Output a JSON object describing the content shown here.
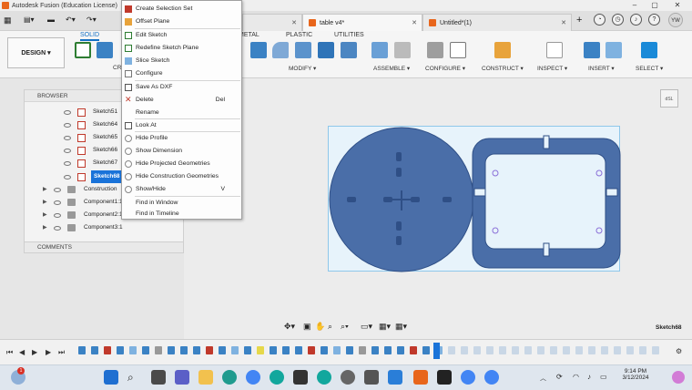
{
  "window": {
    "title": "Autodesk Fusion (Education License)",
    "minimize": "–",
    "maximize": "▢",
    "close": "✕"
  },
  "tabs": [
    {
      "label": "",
      "active": false
    },
    {
      "label": "table v4*",
      "active": true
    },
    {
      "label": "Untitled*(1)",
      "active": false
    }
  ],
  "ribbon": {
    "workspace": "DESIGN ▾",
    "tabs": [
      "SOLID",
      "METAL",
      "PLASTIC",
      "UTILITIES"
    ],
    "groups": [
      "CR",
      "MODIFY ▾",
      "ASSEMBLE ▾",
      "CONFIGURE ▾",
      "CONSTRUCT ▾",
      "INSPECT ▾",
      "INSERT ▾",
      "SELECT ▾"
    ]
  },
  "user": {
    "initials": "YW"
  },
  "browser": {
    "title": "BROWSER",
    "rows": [
      {
        "label": "Sketch51",
        "type": "sketch",
        "selected": false
      },
      {
        "label": "Sketch64",
        "type": "sketch",
        "selected": false
      },
      {
        "label": "Sketch65",
        "type": "sketch",
        "selected": false
      },
      {
        "label": "Sketch66",
        "type": "sketch",
        "selected": false
      },
      {
        "label": "Sketch67",
        "type": "sketch",
        "selected": false
      },
      {
        "label": "Sketch68",
        "type": "sketch",
        "selected": true
      },
      {
        "label": "Construction",
        "type": "folder",
        "selected": false
      },
      {
        "label": "Component1:1",
        "type": "component",
        "selected": false
      },
      {
        "label": "Component2:1",
        "type": "component",
        "selected": false
      },
      {
        "label": "Component3:1",
        "type": "component",
        "selected": false
      }
    ],
    "comments": "COMMENTS"
  },
  "context_menu": {
    "items": [
      {
        "label": "Create Selection Set",
        "shortcut": ""
      },
      {
        "label": "Offset Plane",
        "shortcut": ""
      },
      {
        "label": "Edit Sketch",
        "shortcut": ""
      },
      {
        "label": "Redefine Sketch Plane",
        "shortcut": ""
      },
      {
        "label": "Slice Sketch",
        "shortcut": ""
      },
      {
        "label": "Configure",
        "shortcut": ""
      },
      {
        "label": "Save As DXF",
        "shortcut": ""
      },
      {
        "label": "Delete",
        "shortcut": "Del"
      },
      {
        "label": "Rename",
        "shortcut": ""
      },
      {
        "label": "Look At",
        "shortcut": ""
      },
      {
        "label": "Hide Profile",
        "shortcut": ""
      },
      {
        "label": "Show Dimension",
        "shortcut": ""
      },
      {
        "label": "Hide Projected Geometries",
        "shortcut": ""
      },
      {
        "label": "Hide Construction Geometries",
        "shortcut": ""
      },
      {
        "label": "Show/Hide",
        "shortcut": "V"
      },
      {
        "label": "Find in Window",
        "shortcut": ""
      },
      {
        "label": "Find in Timeline",
        "shortcut": ""
      }
    ]
  },
  "canvas": {
    "active_sketch": "Sketch68",
    "viewcube_label": "dSL"
  },
  "taskbar": {
    "time": "9:14 PM",
    "date": "3/12/2024",
    "notification_badge": "1"
  },
  "colors": {
    "accent": "#1a73d9",
    "sketch_fill": "#4a6ea8",
    "canvas_bg": "#ececec",
    "highlight": "#e8661c"
  }
}
